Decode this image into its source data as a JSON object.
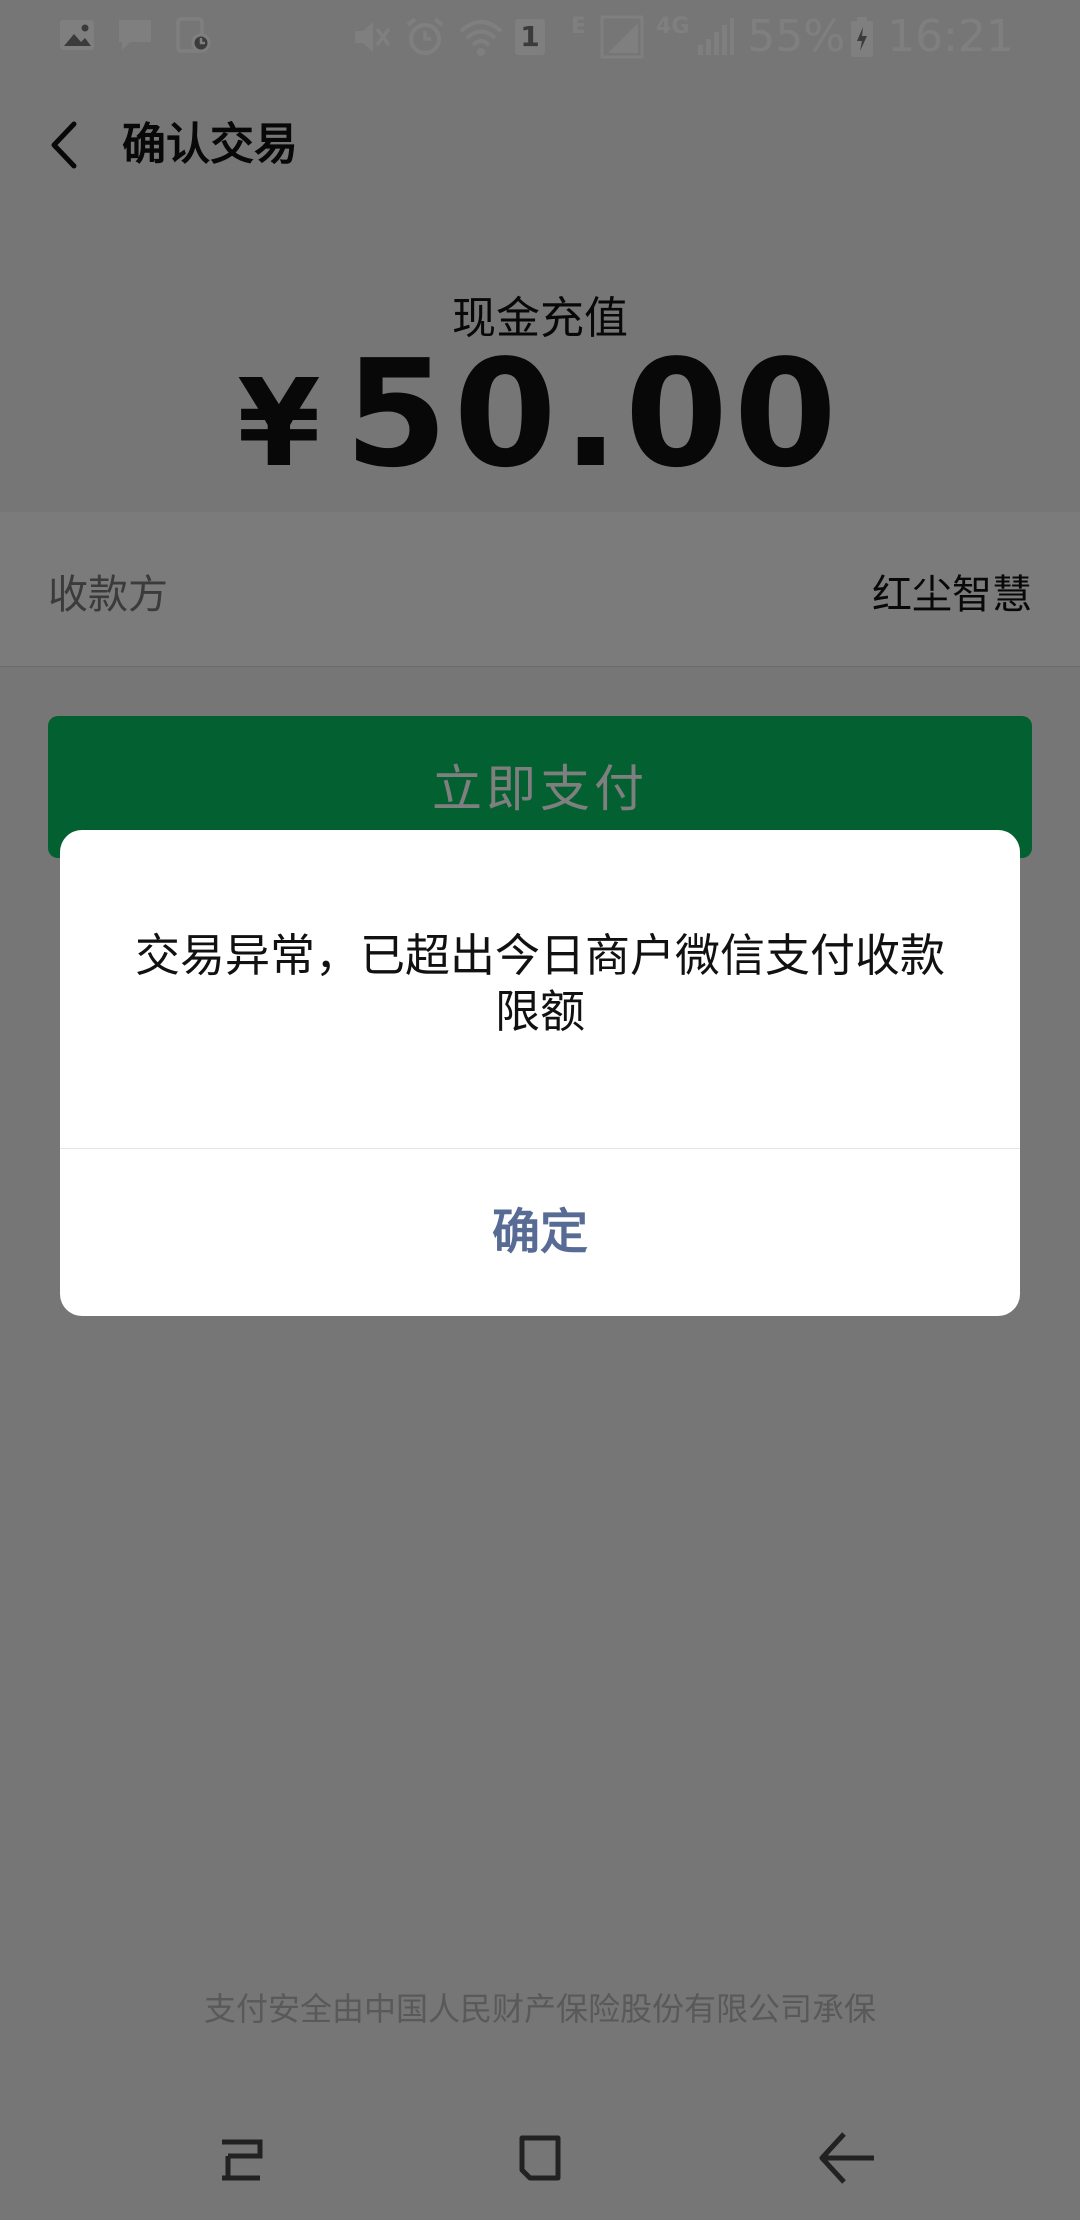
{
  "status_bar": {
    "battery": "55%",
    "time": "16:21",
    "network_e": "E",
    "network_4g": "4G",
    "sim_badge": "1",
    "left_icons": [
      "image-icon",
      "message-icon",
      "screenshot-icon"
    ],
    "right_icons": [
      "mute-icon",
      "alarm-icon",
      "wifi-icon",
      "signal-icon",
      "signal-icon",
      "battery-icon"
    ]
  },
  "header": {
    "title": "确认交易",
    "back_icon": "chevron-left-icon"
  },
  "payment": {
    "label": "现金充值",
    "currency": "¥",
    "amount": "50.00"
  },
  "payee": {
    "label": "收款方",
    "value": "红尘智慧"
  },
  "pay_button": {
    "label": "立即支付"
  },
  "footer": {
    "note": "支付安全由中国人民财产保险股份有限公司承保"
  },
  "dialog": {
    "message": "交易异常，已超出今日商户微信支付收款限额",
    "confirm_label": "确定"
  },
  "nav_bar": {
    "icons": [
      "recent-apps-icon",
      "home-icon",
      "back-icon"
    ]
  },
  "colors": {
    "accent": "#07c160",
    "link": "#576b95",
    "background": "#ededed"
  }
}
